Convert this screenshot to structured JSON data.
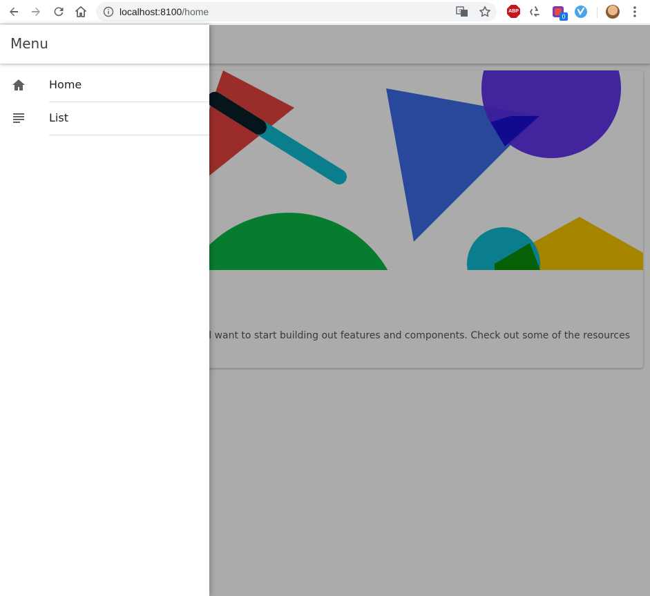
{
  "browser": {
    "url_host": "localhost:8100",
    "url_path": "/home",
    "extensions": {
      "abp_label": "ABP",
      "badge_count": "0"
    },
    "icons": [
      "back-icon",
      "forward-icon",
      "reload-icon",
      "home-icon",
      "info-icon",
      "translate-icon",
      "star-icon",
      "recycle-icon",
      "pocket-icon",
      "avatar",
      "more-icon"
    ]
  },
  "menu": {
    "title": "Menu",
    "items": [
      {
        "label": "Home",
        "icon": "home-icon"
      },
      {
        "label": "List",
        "icon": "list-icon"
      }
    ]
  },
  "main": {
    "card_text": "u'll want to start building out features and components. Check out some of the resources"
  },
  "colors": {
    "red": "#e53935",
    "teal": "#0fbcd1",
    "blue": "#3366e6",
    "purple": "#5b2be8",
    "green": "#0bb845",
    "yellow": "#f7c600"
  }
}
